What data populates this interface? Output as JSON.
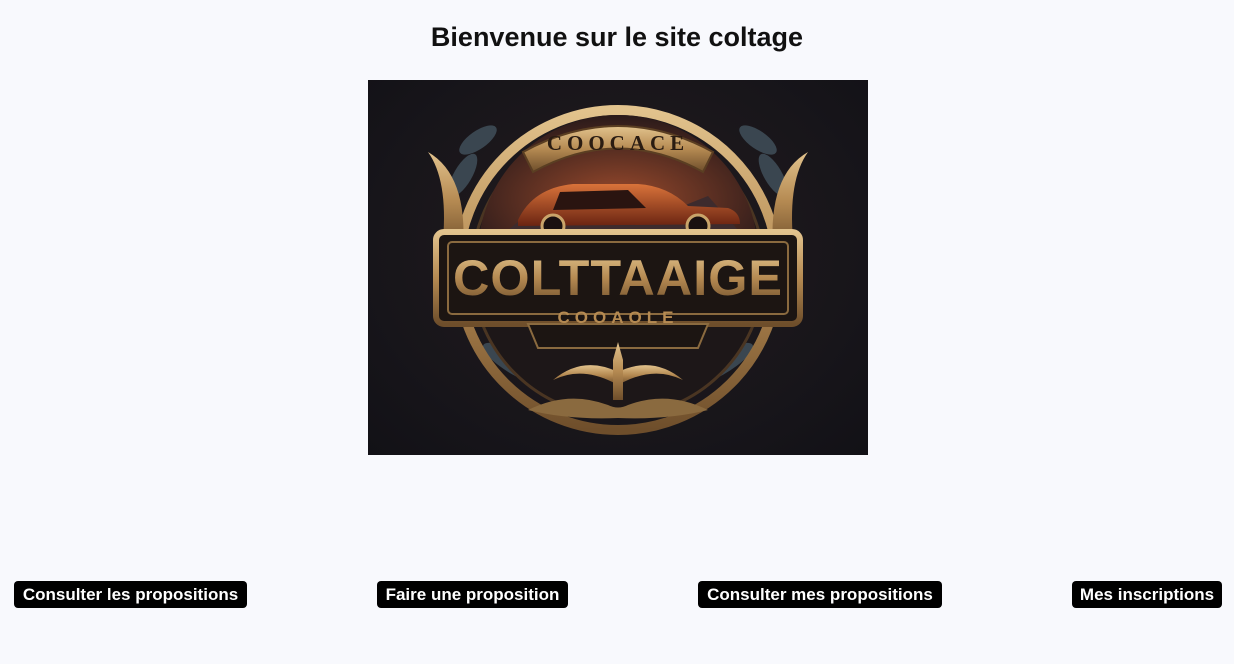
{
  "page": {
    "title": "Bienvenue sur le site coltage"
  },
  "logo": {
    "top_arc_text": "COOCACE",
    "main_text": "COLTTAAIGE",
    "sub_text": "COOAOLE",
    "colors": {
      "background": "#17151a",
      "gold": "#c9a46a",
      "gold_dark": "#7a5a33",
      "car": "#a8461f",
      "leaf": "#3e4a52"
    }
  },
  "nav": {
    "buttons": [
      {
        "label": "Consulter les propositions"
      },
      {
        "label": "Faire une proposition"
      },
      {
        "label": "Consulter mes propositions"
      },
      {
        "label": "Mes inscriptions"
      }
    ]
  }
}
